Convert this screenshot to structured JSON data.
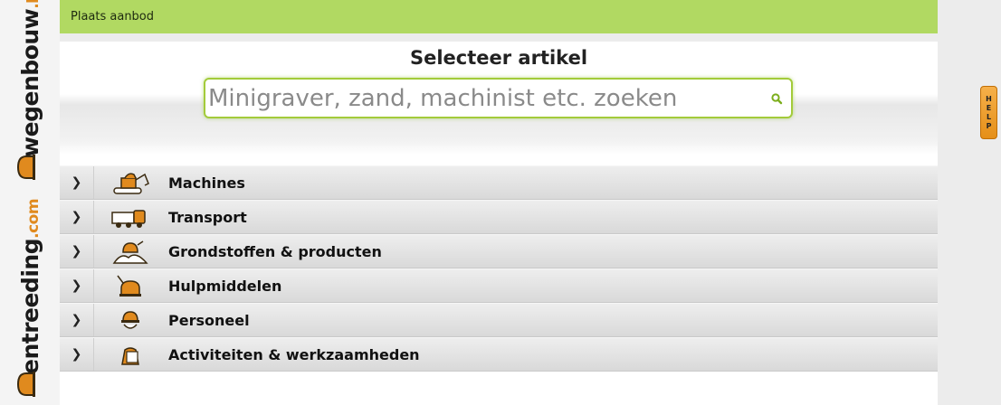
{
  "brand": {
    "name_primary": "entreeding",
    "tld_primary": ".com",
    "name_secondary": "wegenbouw",
    "tld_secondary": ".be",
    "accent": "#e08a1e"
  },
  "topbar": {
    "link": "Plaats aanbod",
    "color": "#b1d962"
  },
  "search": {
    "title": "Selecteer artikel",
    "placeholder": "Minigraver, zand, machinist etc. zoeken"
  },
  "categories": [
    {
      "label": "Machines",
      "icon": "excavator-icon"
    },
    {
      "label": "Transport",
      "icon": "truck-icon"
    },
    {
      "label": "Grondstoffen & producten",
      "icon": "sand-pile-icon"
    },
    {
      "label": "Hulpmiddelen",
      "icon": "tools-icon"
    },
    {
      "label": "Personeel",
      "icon": "worker-icon"
    },
    {
      "label": "Activiteiten & werkzaamheden",
      "icon": "activity-icon"
    }
  ],
  "help": {
    "letters": [
      "H",
      "E",
      "L",
      "P"
    ]
  }
}
